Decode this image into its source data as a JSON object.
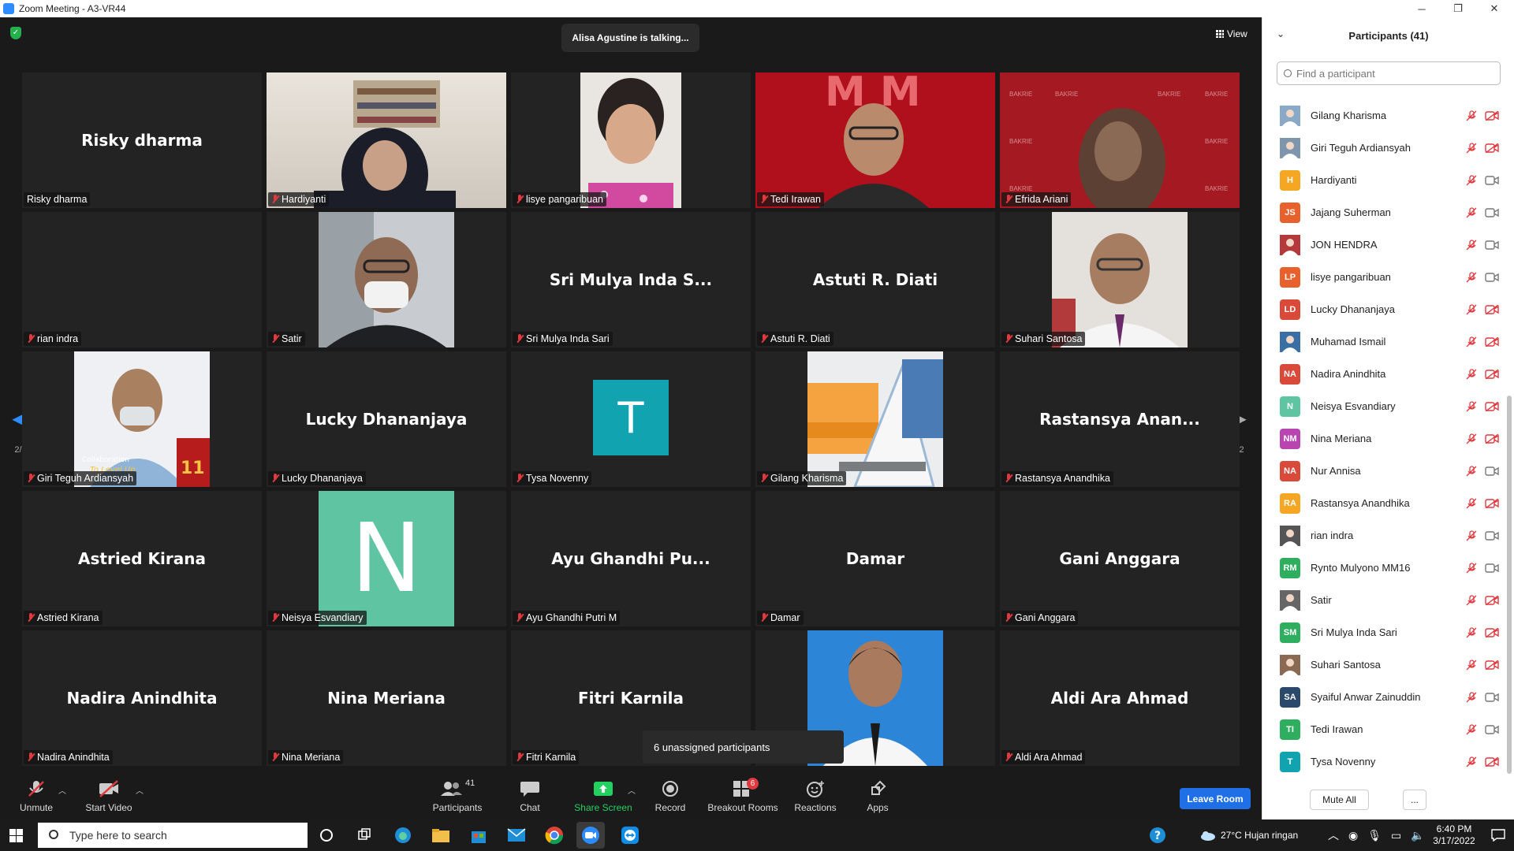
{
  "window": {
    "title": "Zoom Meeting - A3-VR44",
    "minimize": "─",
    "maximize": "❐",
    "close": "✕"
  },
  "meeting": {
    "talking": "Alisa Agustine is talking...",
    "view_label": "View",
    "page_indicator": "2/2",
    "unassigned": "6 unassigned participants"
  },
  "tiles": [
    {
      "big": "Risky dharma",
      "label": "Risky dharma",
      "muted": false
    },
    {
      "big": "",
      "label": "Hardiyanti",
      "muted": true,
      "video": "hardiyanti"
    },
    {
      "big": "",
      "label": "lisye pangaribuan",
      "muted": true,
      "video": "lisye"
    },
    {
      "big": "",
      "label": "Tedi Irawan",
      "muted": true,
      "video": "tedi"
    },
    {
      "big": "",
      "label": "Efrida Ariani",
      "muted": true,
      "video": "efrida"
    },
    {
      "big": "",
      "label": "rian indra",
      "muted": true
    },
    {
      "big": "",
      "label": "Satir",
      "muted": true,
      "video": "satir"
    },
    {
      "big": "Sri Mulya Inda S...",
      "label": "Sri Mulya Inda Sari",
      "muted": true
    },
    {
      "big": "Astuti R. Diati",
      "label": "Astuti R. Diati",
      "muted": true
    },
    {
      "big": "",
      "label": "Suhari Santosa",
      "muted": true,
      "video": "suhari"
    },
    {
      "big": "",
      "label": "Giri Teguh Ardiansyah",
      "muted": true,
      "video": "giri"
    },
    {
      "big": "Lucky Dhananjaya",
      "label": "Lucky Dhananjaya",
      "muted": true
    },
    {
      "big": "",
      "label": "Tysa Novenny",
      "muted": true,
      "video": "tysa",
      "letter": "T"
    },
    {
      "big": "",
      "label": "Gilang Kharisma",
      "muted": true,
      "video": "gilang"
    },
    {
      "big": "Rastansya Anan...",
      "label": "Rastansya Anandhika",
      "muted": true
    },
    {
      "big": "Astried Kirana",
      "label": "Astried Kirana",
      "muted": true
    },
    {
      "big": "",
      "label": "Neisya Esvandiary",
      "muted": true,
      "video": "neisya",
      "letter": "N"
    },
    {
      "big": "Ayu Ghandhi Pu...",
      "label": "Ayu Ghandhi Putri M",
      "muted": true
    },
    {
      "big": "Damar",
      "label": "Damar",
      "muted": true
    },
    {
      "big": "Gani Anggara",
      "label": "Gani Anggara",
      "muted": true
    },
    {
      "big": "Nadira Anindhita",
      "label": "Nadira Anindhita",
      "muted": true
    },
    {
      "big": "Nina Meriana",
      "label": "Nina Meriana",
      "muted": true
    },
    {
      "big": "Fitri Karnila",
      "label": "Fitri Karnila",
      "muted": true
    },
    {
      "big": "",
      "label": "",
      "muted": false,
      "video": "student"
    },
    {
      "big": "Aldi Ara Ahmad",
      "label": "Aldi Ara Ahmad",
      "muted": true
    }
  ],
  "toolbar": {
    "unmute": "Unmute",
    "start_video": "Start Video",
    "participants": "Participants",
    "participants_count": "41",
    "chat": "Chat",
    "share_screen": "Share Screen",
    "record": "Record",
    "breakout_rooms": "Breakout Rooms",
    "breakout_badge": "6",
    "reactions": "Reactions",
    "apps": "Apps",
    "leave": "Leave Room"
  },
  "panel": {
    "title": "Participants (41)",
    "search_placeholder": "Find a participant",
    "mute_all": "Mute All",
    "more": "...",
    "participants": [
      {
        "name": "Gilang Kharisma",
        "initials": "",
        "color": "#8aa9c7",
        "photo": true,
        "cam_off": true
      },
      {
        "name": "Giri Teguh Ardiansyah",
        "initials": "",
        "color": "#7f95ad",
        "photo": true,
        "cam_off": true
      },
      {
        "name": "Hardiyanti",
        "initials": "H",
        "color": "#f5a623",
        "photo": false,
        "cam_off": false
      },
      {
        "name": "Jajang Suherman",
        "initials": "JS",
        "color": "#e8612c",
        "photo": false,
        "cam_off": false
      },
      {
        "name": "JON HENDRA",
        "initials": "",
        "color": "#b5393b",
        "photo": true,
        "cam_off": false
      },
      {
        "name": "lisye pangaribuan",
        "initials": "LP",
        "color": "#e8612c",
        "photo": false,
        "cam_off": false
      },
      {
        "name": "Lucky Dhananjaya",
        "initials": "LD",
        "color": "#d94a3a",
        "photo": false,
        "cam_off": true
      },
      {
        "name": "Muhamad Ismail",
        "initials": "",
        "color": "#3a6ea5",
        "photo": true,
        "cam_off": true
      },
      {
        "name": "Nadira Anindhita",
        "initials": "NA",
        "color": "#d94a3a",
        "photo": false,
        "cam_off": true
      },
      {
        "name": "Neisya Esvandiary",
        "initials": "N",
        "color": "#5fc4a1",
        "photo": false,
        "cam_off": true
      },
      {
        "name": "Nina Meriana",
        "initials": "NM",
        "color": "#b845b0",
        "photo": false,
        "cam_off": true
      },
      {
        "name": "Nur Annisa",
        "initials": "NA",
        "color": "#d94a3a",
        "photo": false,
        "cam_off": false
      },
      {
        "name": "Rastansya Anandhika",
        "initials": "RA",
        "color": "#f5a623",
        "photo": false,
        "cam_off": true
      },
      {
        "name": "rian indra",
        "initials": "",
        "color": "#555555",
        "photo": true,
        "cam_off": false
      },
      {
        "name": "Rynto Mulyono MM16",
        "initials": "RM",
        "color": "#2fae5f",
        "photo": false,
        "cam_off": false
      },
      {
        "name": "Satir",
        "initials": "",
        "color": "#666666",
        "photo": true,
        "cam_off": true
      },
      {
        "name": "Sri Mulya Inda Sari",
        "initials": "SM",
        "color": "#2fae5f",
        "photo": false,
        "cam_off": true
      },
      {
        "name": "Suhari Santosa",
        "initials": "",
        "color": "#8a6a52",
        "photo": true,
        "cam_off": true
      },
      {
        "name": "Syaiful Anwar Zainuddin",
        "initials": "SA",
        "color": "#2b4a6b",
        "photo": false,
        "cam_off": false
      },
      {
        "name": "Tedi Irawan",
        "initials": "TI",
        "color": "#2fae5f",
        "photo": false,
        "cam_off": false
      },
      {
        "name": "Tysa Novenny",
        "initials": "T",
        "color": "#12a3b0",
        "photo": false,
        "cam_off": true
      }
    ]
  },
  "taskbar": {
    "search_placeholder": "Type here to search",
    "weather": "27°C  Hujan ringan",
    "time": "6:40 PM",
    "date": "3/17/2022"
  }
}
